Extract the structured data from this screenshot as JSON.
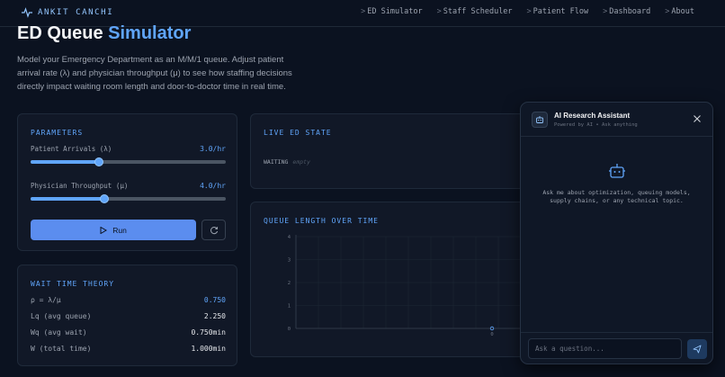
{
  "brand": {
    "name": "ANKIT CANCHI",
    "icon": "activity-icon"
  },
  "nav": {
    "items": [
      {
        "label": "ED Simulator"
      },
      {
        "label": "Staff Scheduler"
      },
      {
        "label": "Patient Flow"
      },
      {
        "label": "Dashboard"
      },
      {
        "label": "About"
      }
    ]
  },
  "hero": {
    "title_main": "ED Queue",
    "title_accent": "Simulator",
    "description": "Model your Emergency Department as an M/M/1 queue. Adjust patient arrival rate (λ) and physician throughput (μ) to see how staffing decisions directly impact waiting room length and door-to-doctor time in real time."
  },
  "parameters": {
    "title": "PARAMETERS",
    "arrivals": {
      "label": "Patient Arrivals (λ)",
      "value_text": "3.0/hr",
      "fraction": 0.35
    },
    "throughput": {
      "label": "Physician Throughput (μ)",
      "value_text": "4.0/hr",
      "fraction": 0.38
    },
    "run_label": "Run"
  },
  "theory": {
    "title": "WAIT TIME THEORY",
    "rows": [
      {
        "key": "ρ = λ/μ",
        "value": "0.750"
      },
      {
        "key": "Lq (avg queue)",
        "value": "2.250"
      },
      {
        "key": "Wq (avg wait)",
        "value": "0.750min"
      },
      {
        "key": "W (total time)",
        "value": "1.000min"
      }
    ]
  },
  "live": {
    "title": "LIVE ED STATE",
    "waiting_label": "WAITING",
    "waiting_value": "empty"
  },
  "queue_chart": {
    "title": "QUEUE LENGTH OVER TIME"
  },
  "chart_data": {
    "type": "line",
    "title": "QUEUE LENGTH OVER TIME",
    "xlabel": "",
    "ylabel": "",
    "ylim": [
      0,
      4
    ],
    "yticks": [
      "0",
      "1",
      "2",
      "3",
      "4"
    ],
    "xticks": [
      "0"
    ],
    "grid": true,
    "series": [
      {
        "x": [
          0
        ],
        "values": [
          0
        ]
      }
    ]
  },
  "assistant": {
    "title": "AI Research Assistant",
    "subtitle": "Powered by AI • Ask anything",
    "hint": "Ask me about optimization, queuing models, supply chains, or any technical topic.",
    "input_placeholder": "Ask a question..."
  },
  "colors": {
    "accent": "#60a5fa",
    "background": "#0b1220",
    "card": "#111827",
    "button": "#5b8def"
  }
}
